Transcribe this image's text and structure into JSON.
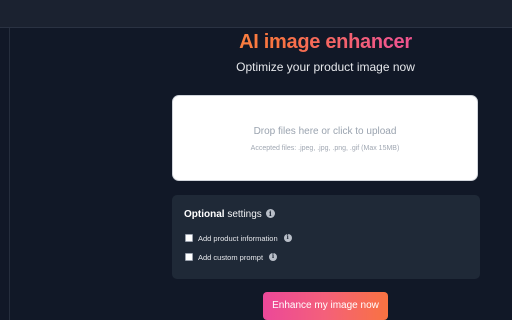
{
  "header": {
    "title": "AI image enhancer",
    "subtitle": "Optimize your product image now"
  },
  "upload": {
    "prompt": "Drop files here or click to upload",
    "accepted": "Accepted files: .jpeg, .jpg, .png, .gif (Max 15MB)"
  },
  "settings": {
    "title_bold": "Optional",
    "title_rest": " settings",
    "info_icon": "info-icon",
    "options": [
      {
        "label": "Add product information",
        "checked": false
      },
      {
        "label": "Add custom prompt",
        "checked": false
      }
    ]
  },
  "action": {
    "label": "Enhance my image now"
  },
  "colors": {
    "background": "#111827",
    "panel": "#1f2937",
    "gradient_start": "#fb923c",
    "gradient_end": "#ec4899"
  }
}
